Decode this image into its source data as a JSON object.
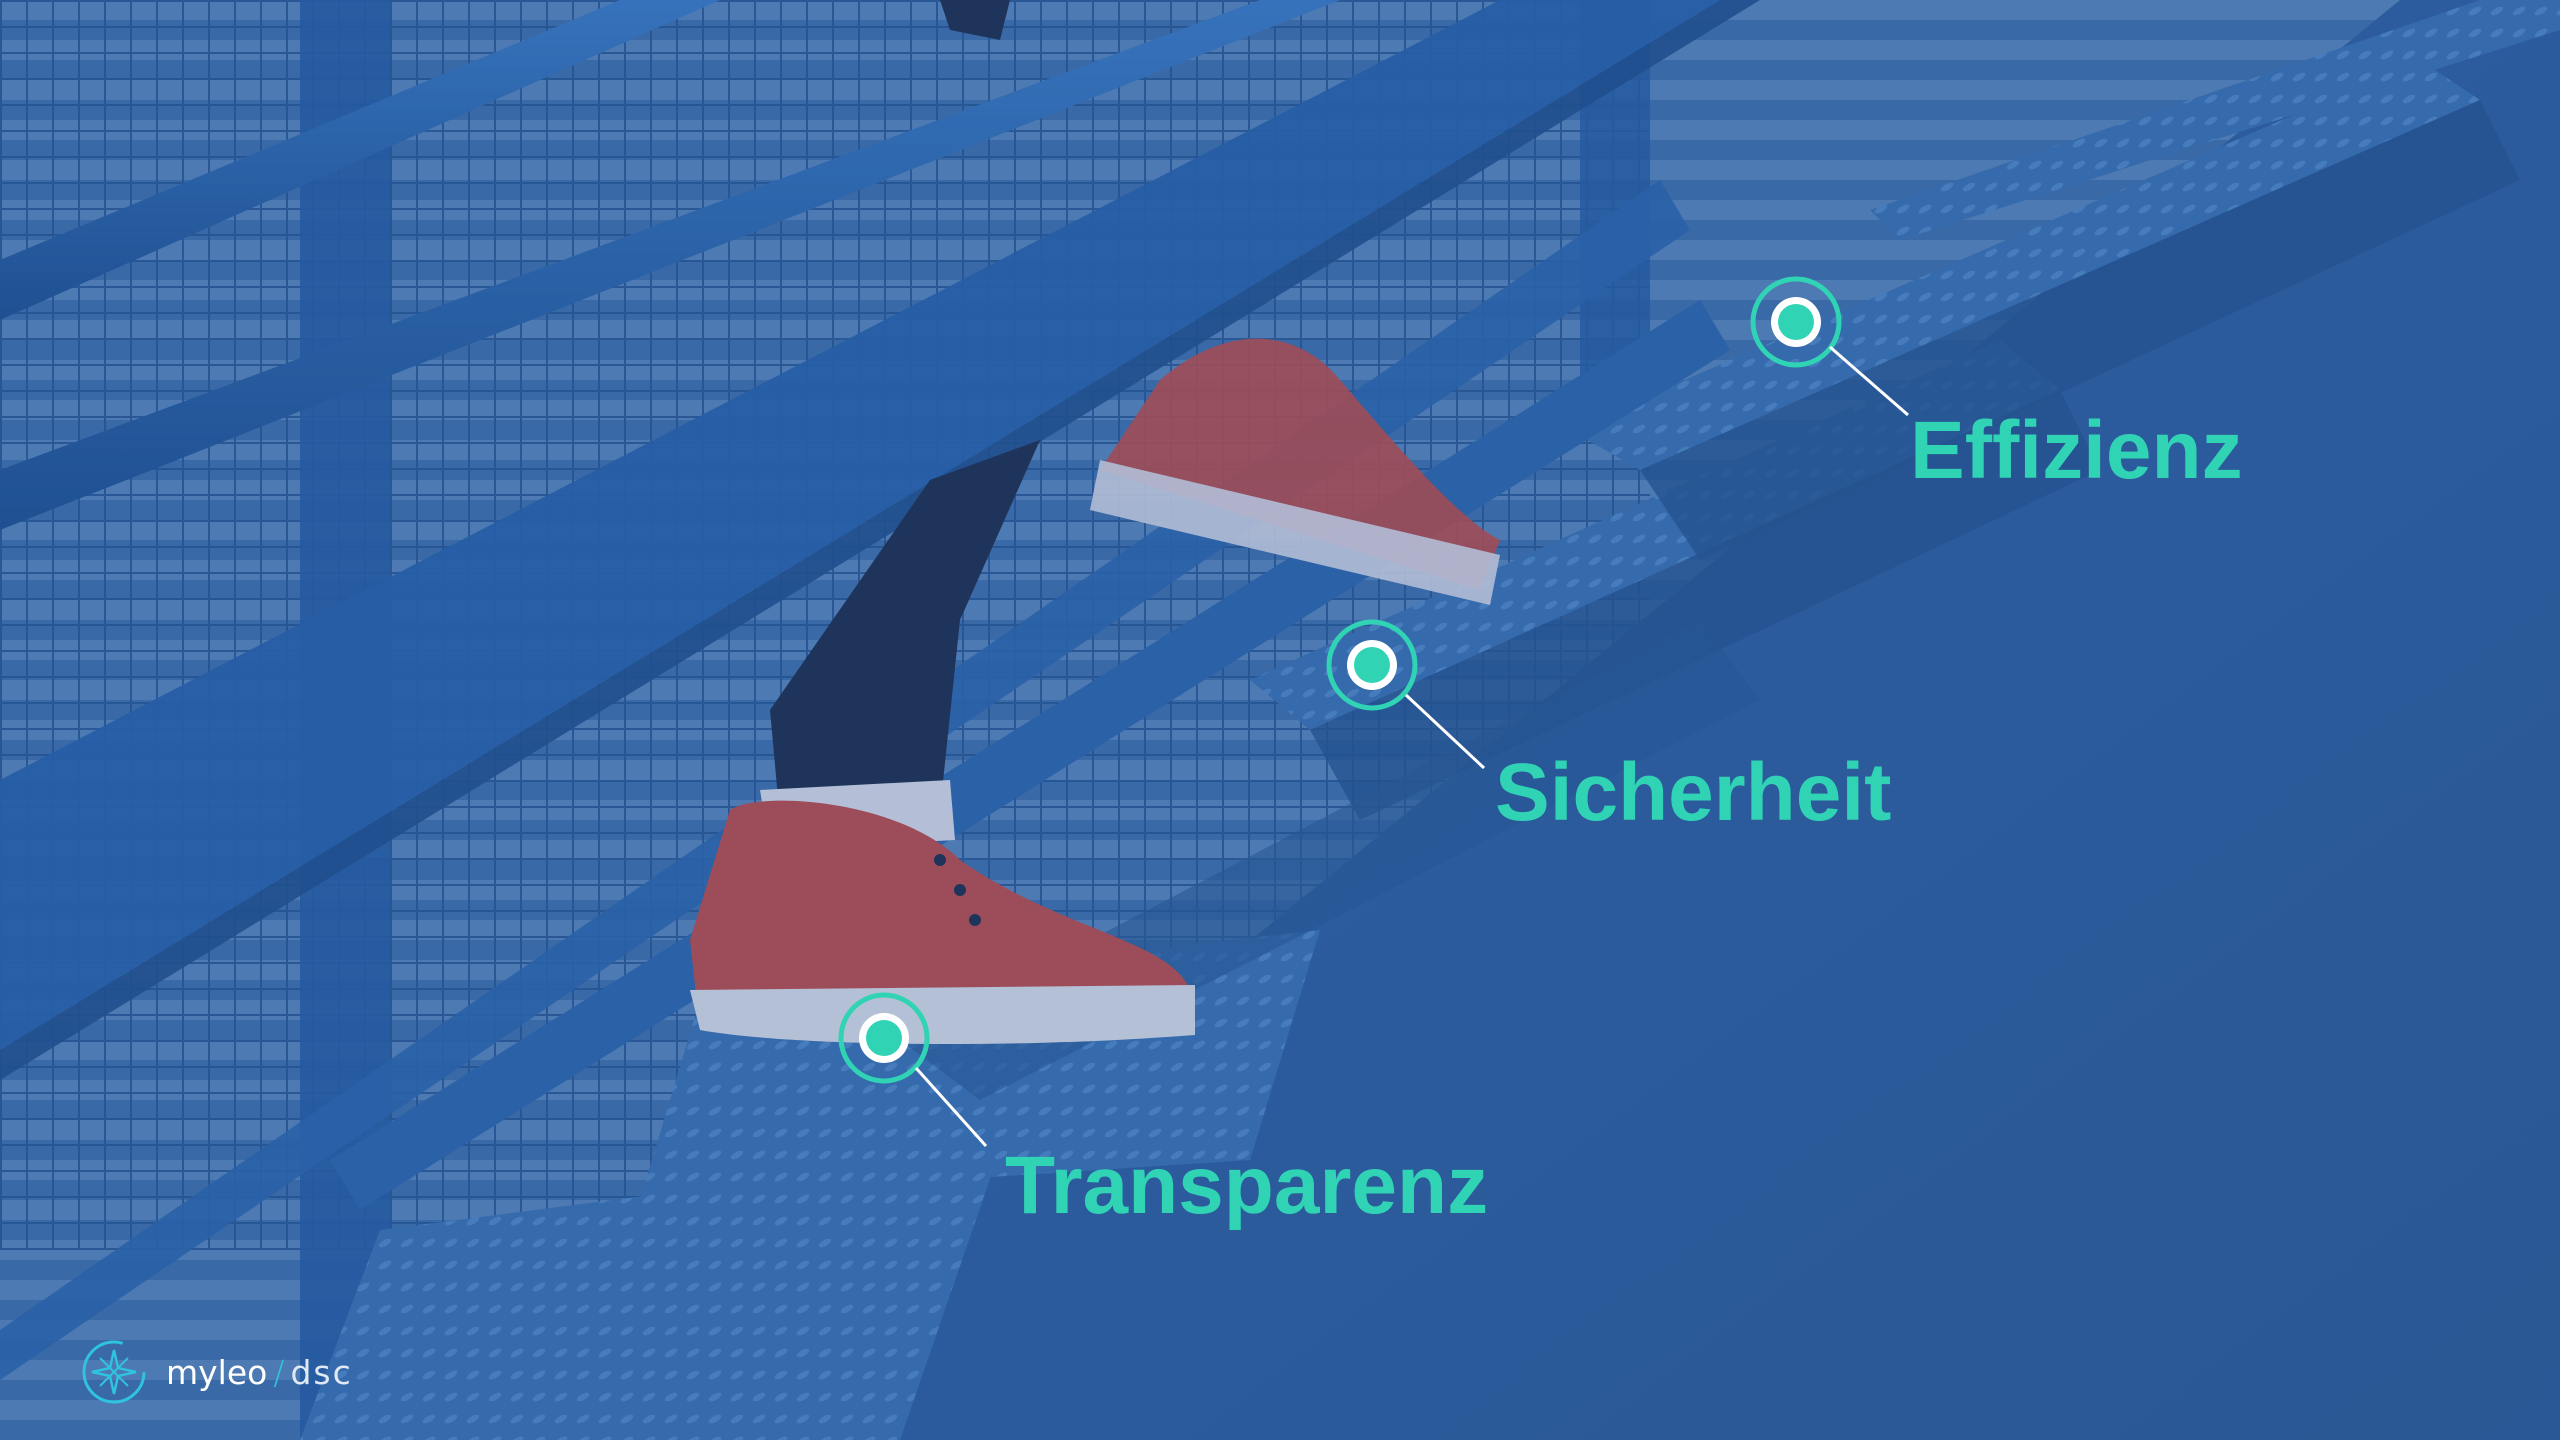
{
  "slide": {
    "hotspots": [
      {
        "id": "effizienz",
        "label": "Effizienz"
      },
      {
        "id": "sicherheit",
        "label": "Sicherheit"
      },
      {
        "id": "transparenz",
        "label": "Transparenz"
      }
    ],
    "accent_color": "#31d3b5",
    "overlay_color": "#2a5ea3"
  },
  "brand": {
    "name": "myleo",
    "separator": "/",
    "product": "dsc",
    "logo_icon": "compass-star-icon"
  }
}
